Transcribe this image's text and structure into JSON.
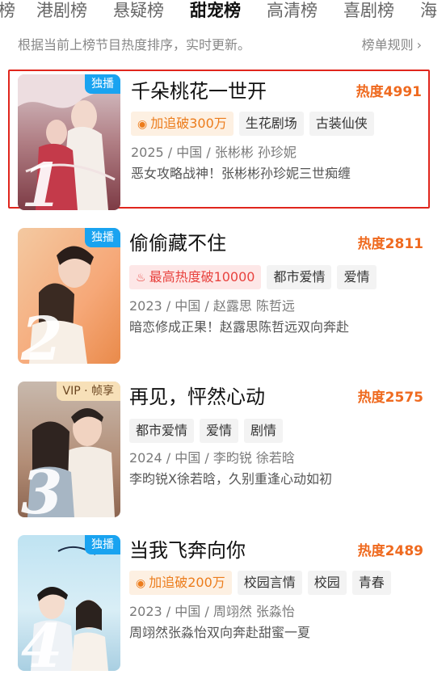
{
  "tabs": [
    {
      "label": "榜"
    },
    {
      "label": "港剧榜"
    },
    {
      "label": "悬疑榜"
    },
    {
      "label": "甜宠榜"
    },
    {
      "label": "高清榜"
    },
    {
      "label": "喜剧榜"
    },
    {
      "label": "海"
    }
  ],
  "active_tab": "甜宠榜",
  "subheader": {
    "text": "根据当前上榜节目热度排序，实时更新。",
    "rules_label": "榜单规则",
    "rules_icon": "chevron-right-icon"
  },
  "colors": {
    "accent_orange": "#ef6a1f",
    "highlight_border": "#e0261d",
    "exclusive_badge": "#19a3f0",
    "vip_badge": "#f7e0b8"
  },
  "items": [
    {
      "rank": "1",
      "badge": "独播",
      "title": "千朵桃花一世开",
      "heat": "热度4991",
      "tags": [
        {
          "label": "加追破300万",
          "icon": "play-circle-icon"
        },
        {
          "label": "生花剧场"
        },
        {
          "label": "古装仙侠"
        }
      ],
      "meta": "2025 / 中国 / 张彬彬 孙珍妮",
      "desc": "恶女攻略战神！张彬彬孙珍妮三世痴缠"
    },
    {
      "rank": "2",
      "badge": "独播",
      "title": "偷偷藏不住",
      "heat": "热度2811",
      "tags": [
        {
          "label": "最高热度破10000",
          "icon": "flame-icon"
        },
        {
          "label": "都市爱情"
        },
        {
          "label": "爱情"
        }
      ],
      "meta": "2023 / 中国 / 赵露思 陈哲远",
      "desc": "暗恋修成正果！赵露思陈哲远双向奔赴"
    },
    {
      "rank": "3",
      "badge": "VIP · 帧享",
      "title": "再见，怦然心动",
      "heat": "热度2575",
      "tags": [
        {
          "label": "都市爱情"
        },
        {
          "label": "爱情"
        },
        {
          "label": "剧情"
        }
      ],
      "meta": "2024 / 中国 / 李昀锐 徐若晗",
      "desc": "李昀锐X徐若晗，久别重逢心动如初"
    },
    {
      "rank": "4",
      "badge": "独播",
      "title": "当我飞奔向你",
      "heat": "热度2489",
      "tags": [
        {
          "label": "加追破200万",
          "icon": "play-circle-icon"
        },
        {
          "label": "校园言情"
        },
        {
          "label": "校园"
        },
        {
          "label": "青春"
        }
      ],
      "meta": "2023 / 中国 / 周翊然 张淼怡",
      "desc": "周翊然张淼怡双向奔赴甜蜜一夏"
    }
  ]
}
